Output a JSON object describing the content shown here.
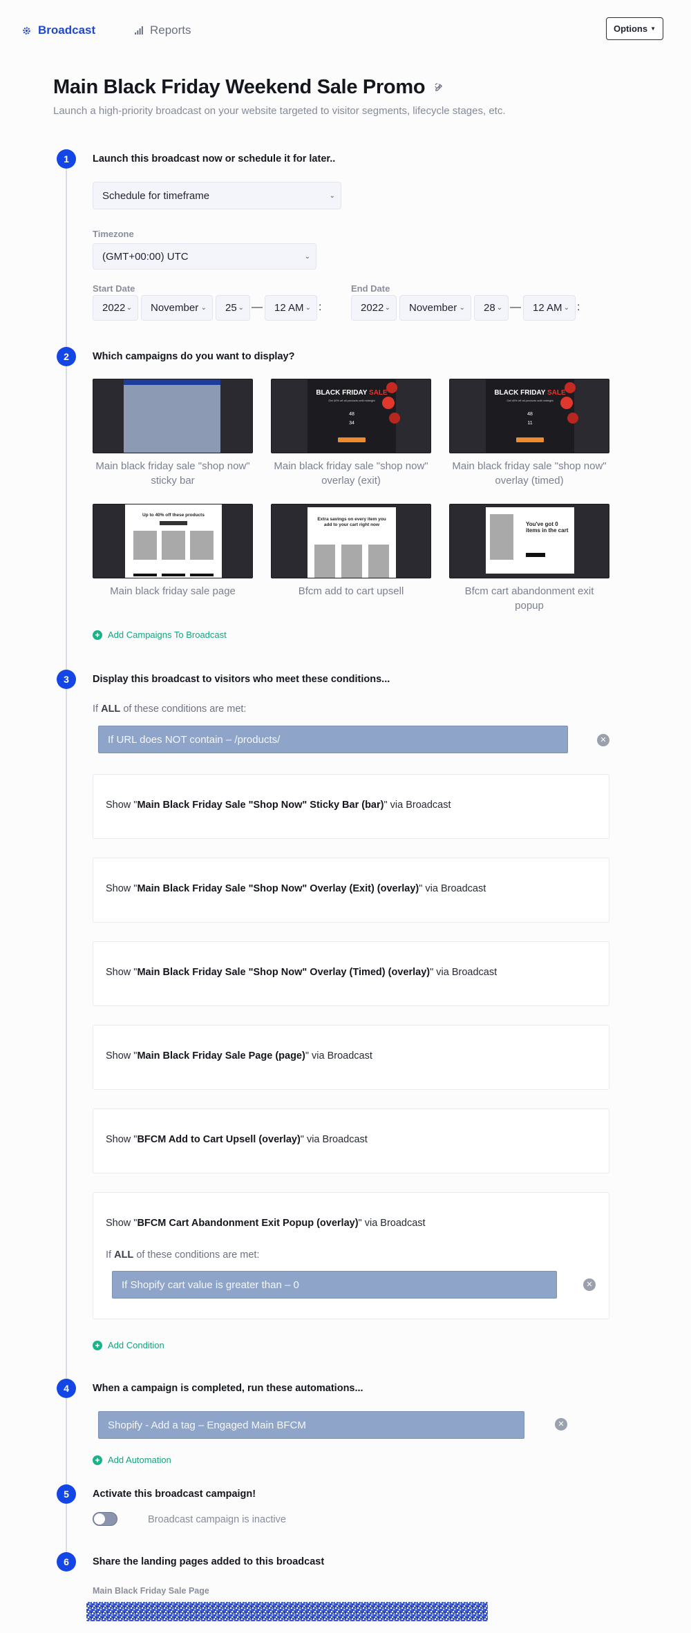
{
  "nav": {
    "broadcast_label": "Broadcast",
    "reports_label": "Reports",
    "options_label": "Options"
  },
  "header": {
    "title": "Main Black Friday Weekend Sale Promo",
    "subtitle": "Launch a high-priority broadcast on your website targeted to visitor segments, lifecycle stages, etc."
  },
  "step1": {
    "number": "1",
    "title": "Launch this broadcast now or schedule it for later..",
    "schedule_select": "Schedule for timeframe",
    "timezone_label": "Timezone",
    "timezone_value": "(GMT+00:00) UTC",
    "start_label": "Start Date",
    "start": {
      "year": "2022",
      "month": "November",
      "day": "25",
      "hour": "12 AM"
    },
    "end_label": "End Date",
    "end": {
      "year": "2022",
      "month": "November",
      "day": "28",
      "hour": "12 AM"
    },
    "dash": "—",
    "colon": ":"
  },
  "step2": {
    "number": "2",
    "title": "Which campaigns do you want to display?",
    "campaigns": [
      {
        "caption": "Main black friday sale \"shop now\" sticky bar"
      },
      {
        "caption": "Main black friday sale \"shop now\" overlay (exit)"
      },
      {
        "caption": "Main black friday sale \"shop now\" overlay (timed)"
      },
      {
        "caption": "Main black friday sale page"
      },
      {
        "caption": "Bfcm add to cart upsell"
      },
      {
        "caption": "Bfcm cart abandonment exit popup"
      }
    ],
    "thumb_text": {
      "bf_black": "BLACK FRIDAY",
      "bf_sale": "SALE",
      "bf_sub": "Get 40% off all products until midnight",
      "bf_num1": "48",
      "bf_num2a": "34",
      "bf_num2b": "11",
      "page_heading": "Up to 40% off these products",
      "upsell_heading": "Extra savings on every item you add to your cart right now",
      "cart_heading": "You've got 0 items in the cart"
    },
    "add_label": "Add Campaigns To Broadcast"
  },
  "step3": {
    "number": "3",
    "title": "Display this broadcast to visitors who meet these conditions...",
    "intro_prefix": "If",
    "intro_bold": "ALL",
    "intro_suffix": "of these conditions are met:",
    "condition": "If URL does NOT contain – /products/",
    "shows": [
      {
        "prefix": "Show \"",
        "name": "Main Black Friday Sale \"Shop Now\" Sticky Bar (bar)",
        "suffix": "\" via Broadcast"
      },
      {
        "prefix": "Show \"",
        "name": "Main Black Friday Sale \"Shop Now\" Overlay (Exit) (overlay)",
        "suffix": "\" via Broadcast"
      },
      {
        "prefix": "Show \"",
        "name": "Main Black Friday Sale \"Shop Now\" Overlay (Timed) (overlay)",
        "suffix": "\" via Broadcast"
      },
      {
        "prefix": "Show \"",
        "name": "Main Black Friday Sale Page (page)",
        "suffix": "\" via Broadcast"
      },
      {
        "prefix": "Show \"",
        "name": "BFCM Add to Cart Upsell (overlay)",
        "suffix": "\" via Broadcast"
      },
      {
        "prefix": "Show \"",
        "name": "BFCM Cart Abandonment Exit Popup (overlay)",
        "suffix": "\" via Broadcast"
      }
    ],
    "nested_condition": "If Shopify cart value is greater than – 0",
    "add_label": "Add Condition"
  },
  "step4": {
    "number": "4",
    "title": "When a campaign is completed, run these automations...",
    "automation": "Shopify - Add a tag – Engaged Main BFCM",
    "add_label": "Add Automation"
  },
  "step5": {
    "number": "5",
    "title": "Activate this broadcast campaign!",
    "toggle_label": "Broadcast campaign is inactive",
    "active": false
  },
  "step6": {
    "number": "6",
    "title": "Share the landing pages added to this broadcast",
    "page_label": "Main Black Friday Sale Page"
  },
  "colors": {
    "accent": "#1446e6",
    "link_green": "#17a37d",
    "condition_bar": "#8ea5c9",
    "sale_red": "#e8332a"
  }
}
